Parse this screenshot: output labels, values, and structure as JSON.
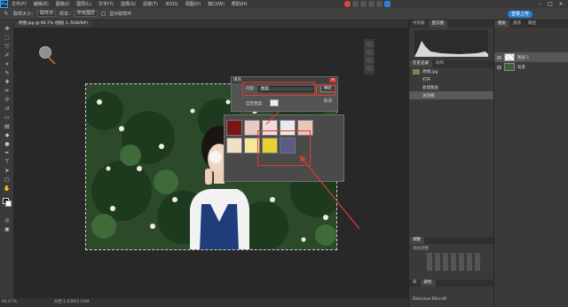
{
  "menubar": {
    "logo": "Ps",
    "items": [
      "文件(F)",
      "编辑(E)",
      "图像(I)",
      "图层(L)",
      "文字(Y)",
      "选择(S)",
      "滤镜(T)",
      "3D(D)",
      "视图(V)",
      "窗口(W)",
      "帮助(H)"
    ],
    "share_label": "登录上传"
  },
  "options_bar": {
    "sample_label": "取样大小：",
    "sample_value": "取样点",
    "sample_from_label": "样本：",
    "sample_from_value": "所有图层",
    "show_ring_label": "显示取样环"
  },
  "document": {
    "tab_title": "原图.jpg @ 66.7% (图层 1, RGB/8#)",
    "zoom_status": "66.67%",
    "doc_size": "文档:1.03M/1.03M"
  },
  "fill_dialog": {
    "title": "填充",
    "content_label": "内容:",
    "content_value": "图案",
    "options_label": "选项",
    "ok_label": "确定",
    "cancel_label": "取消",
    "custom_pattern_label": "自定图案:"
  },
  "pattern_picker": {
    "swatch_colors": [
      "#7a1616",
      "#e8c9c3",
      "#f3d9de",
      "#eaeaea",
      "#e9c6b5",
      "#f0e0c8",
      "#f5e89c",
      "#e8d030",
      "#5b5b86"
    ]
  },
  "right_panels": {
    "top_tabs": [
      "导航器",
      "直方图"
    ],
    "history_tabs": [
      "历史记录",
      "动作"
    ],
    "history_items": [
      "原图.jpg",
      "打开",
      "新建图层",
      "油漆桶"
    ],
    "adjust_tabs": [
      "调整"
    ],
    "adjust_hint": "添加调整",
    "bottom_tabs": [
      "库",
      "颜色"
    ],
    "bottom_font": "Delicious Kitcraft"
  },
  "layers_panel": {
    "tabs": [
      "图层",
      "通道",
      "路径"
    ],
    "layers": [
      "图层 1",
      "背景"
    ]
  },
  "annotation_color": "#e23b2e"
}
